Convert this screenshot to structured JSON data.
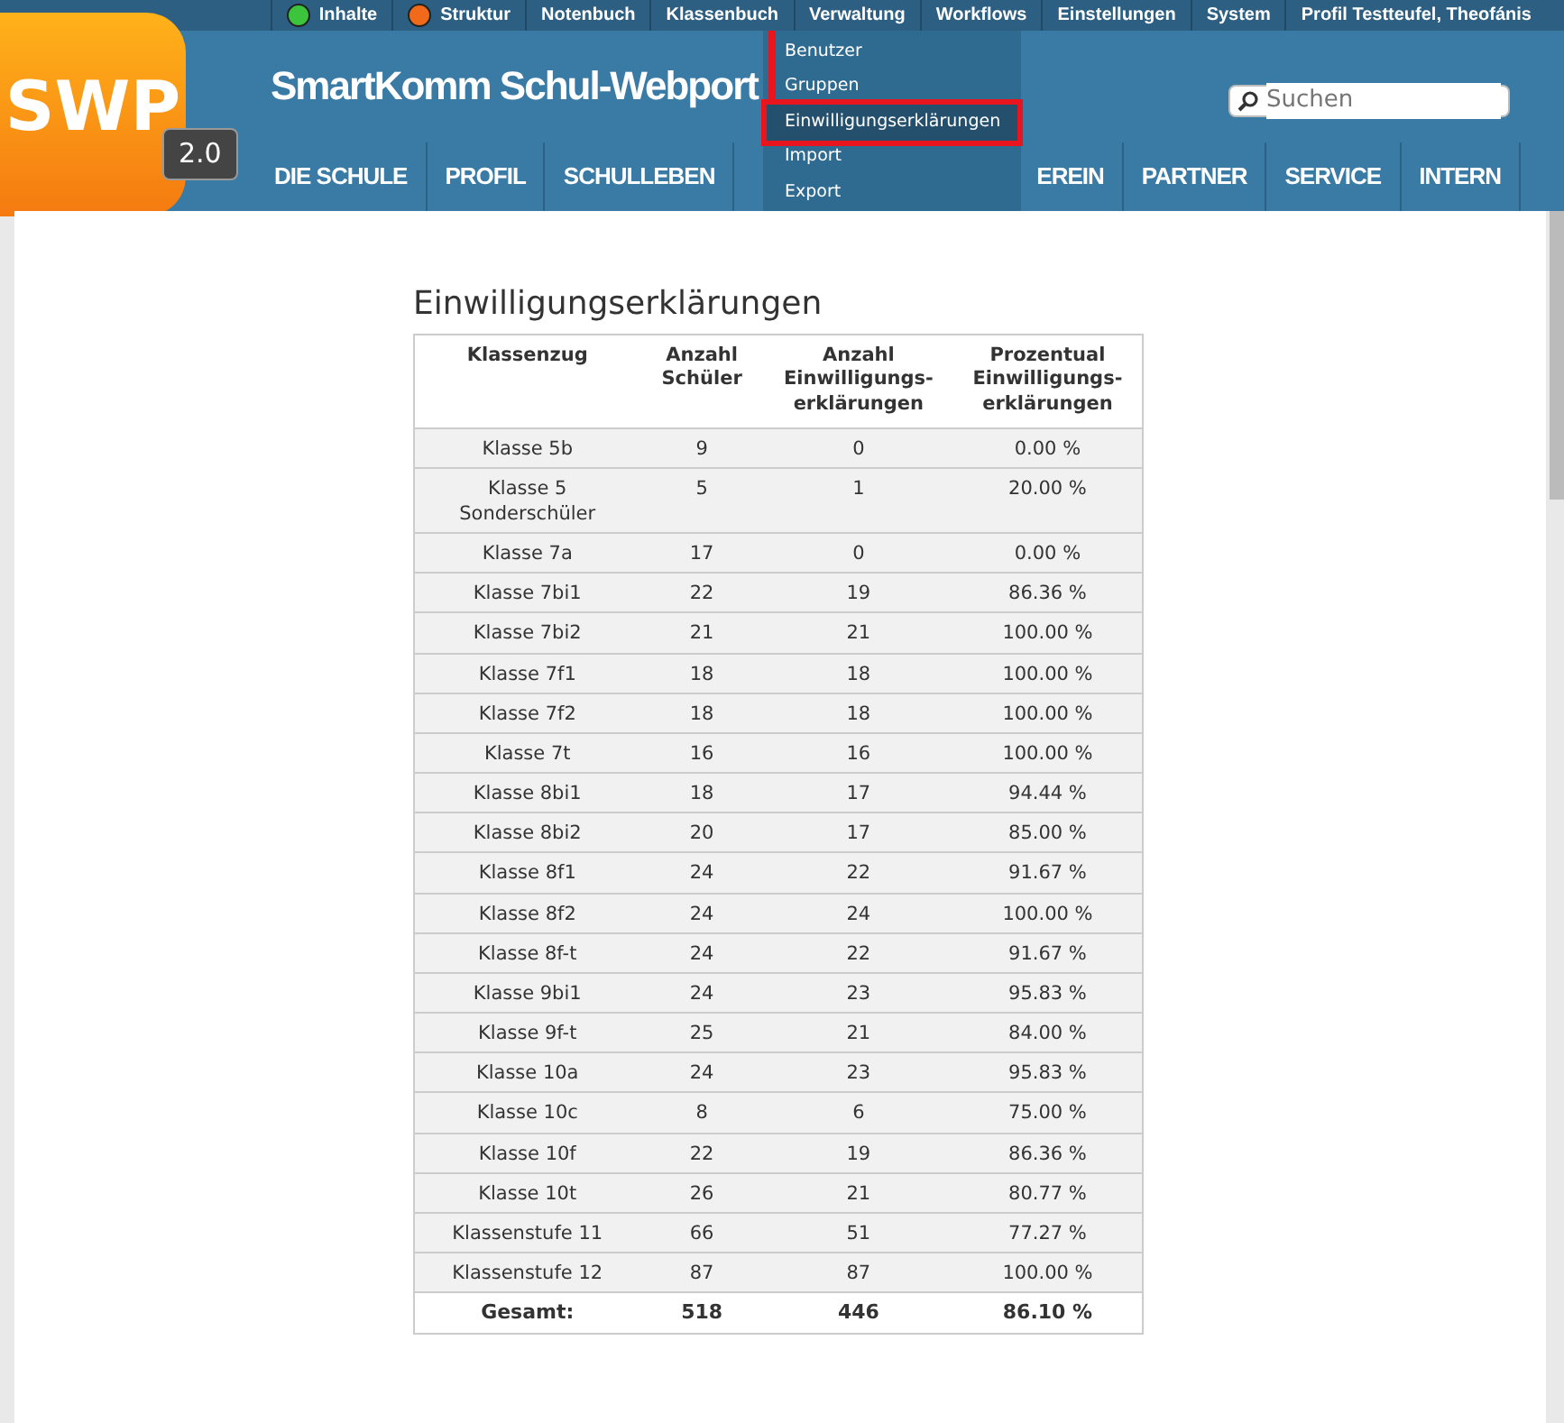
{
  "top_menu": [
    {
      "label": "Inhalte",
      "color": "#3cc43c"
    },
    {
      "label": "Struktur",
      "color": "#f06a1a"
    },
    {
      "label": "Notenbuch"
    },
    {
      "label": "Klassenbuch"
    },
    {
      "label": "Verwaltung"
    },
    {
      "label": "Workflows"
    },
    {
      "label": "Einstellungen"
    },
    {
      "label": "System"
    },
    {
      "label": "Profil Testteufel, Theofánis"
    }
  ],
  "logo": {
    "text": "SWP",
    "version": "2.0"
  },
  "site_title": "SmartKomm Schul-Webport",
  "search": {
    "placeholder": "Suchen"
  },
  "main_nav": [
    {
      "label": "DIE SCHULE"
    },
    {
      "label": "PROFIL"
    },
    {
      "label": "SCHULLEBEN"
    },
    {
      "label": "EREIN",
      "gap_before": true
    },
    {
      "label": "PARTNER"
    },
    {
      "label": "SERVICE"
    },
    {
      "label": "INTERN"
    }
  ],
  "dropdown": {
    "items": [
      {
        "label": "Benutzer",
        "selected": false
      },
      {
        "label": "Gruppen",
        "selected": false
      },
      {
        "label": "Einwilligungserklärungen",
        "selected": true
      },
      {
        "label": "Import",
        "selected": false
      },
      {
        "label": "Export",
        "selected": false
      }
    ]
  },
  "heading": "Einwilligungserklärungen",
  "table": {
    "columns": [
      "Klassenzug",
      "Anzahl Schüler",
      "Anzahl Einwilligungs-erklärungen",
      "Prozentual Einwilligungs-erklärungen"
    ],
    "rows": [
      [
        "Klasse 5b",
        "9",
        "0",
        "0.00 %"
      ],
      [
        "Klasse 5 Sonderschüler",
        "5",
        "1",
        "20.00 %"
      ],
      [
        "Klasse 7a",
        "17",
        "0",
        "0.00 %"
      ],
      [
        "Klasse 7bi1",
        "22",
        "19",
        "86.36 %"
      ],
      [
        "Klasse 7bi2",
        "21",
        "21",
        "100.00 %"
      ],
      [
        "Klasse 7f1",
        "18",
        "18",
        "100.00 %"
      ],
      [
        "Klasse 7f2",
        "18",
        "18",
        "100.00 %"
      ],
      [
        "Klasse 7t",
        "16",
        "16",
        "100.00 %"
      ],
      [
        "Klasse 8bi1",
        "18",
        "17",
        "94.44 %"
      ],
      [
        "Klasse 8bi2",
        "20",
        "17",
        "85.00 %"
      ],
      [
        "Klasse 8f1",
        "24",
        "22",
        "91.67 %"
      ],
      [
        "Klasse 8f2",
        "24",
        "24",
        "100.00 %"
      ],
      [
        "Klasse 8f-t",
        "24",
        "22",
        "91.67 %"
      ],
      [
        "Klasse 9bi1",
        "24",
        "23",
        "95.83 %"
      ],
      [
        "Klasse 9f-t",
        "25",
        "21",
        "84.00 %"
      ],
      [
        "Klasse 10a",
        "24",
        "23",
        "95.83 %"
      ],
      [
        "Klasse 10c",
        "8",
        "6",
        "75.00 %"
      ],
      [
        "Klasse 10f",
        "22",
        "19",
        "86.36 %"
      ],
      [
        "Klasse 10t",
        "26",
        "21",
        "80.77 %"
      ],
      [
        "Klassenstufe 11",
        "66",
        "51",
        "77.27 %"
      ],
      [
        "Klassenstufe 12",
        "87",
        "87",
        "100.00 %"
      ]
    ],
    "total": [
      "Gesamt:",
      "518",
      "446",
      "86.10 %"
    ]
  }
}
